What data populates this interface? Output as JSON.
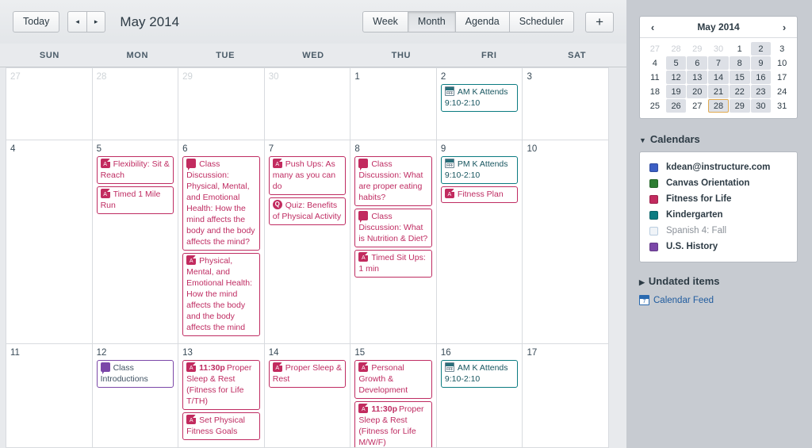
{
  "toolbar": {
    "today_label": "Today",
    "prev_label": "◂",
    "next_label": "▸",
    "month_title": "May 2014",
    "views": [
      {
        "label": "Week",
        "active": false
      },
      {
        "label": "Month",
        "active": true
      },
      {
        "label": "Agenda",
        "active": false
      },
      {
        "label": "Scheduler",
        "active": false
      }
    ],
    "add_label": "+"
  },
  "weekdays": [
    "SUN",
    "MON",
    "TUE",
    "WED",
    "THU",
    "FRI",
    "SAT"
  ],
  "grid": {
    "weeks": [
      {
        "height_class": "r1",
        "days": [
          {
            "num": "27",
            "other": true,
            "events": []
          },
          {
            "num": "28",
            "other": true,
            "events": []
          },
          {
            "num": "29",
            "other": true,
            "events": []
          },
          {
            "num": "30",
            "other": true,
            "events": []
          },
          {
            "num": "1",
            "other": false,
            "events": []
          },
          {
            "num": "2",
            "other": false,
            "events": [
              {
                "icon": "calevent",
                "color": "teal",
                "time": "",
                "title": "AM K Attends 9:10-2:10"
              }
            ]
          },
          {
            "num": "3",
            "other": false,
            "events": []
          }
        ]
      },
      {
        "height_class": "r2",
        "days": [
          {
            "num": "4",
            "other": false,
            "events": []
          },
          {
            "num": "5",
            "other": false,
            "events": [
              {
                "icon": "assignment",
                "color": "pink",
                "time": "",
                "title": "Flexibility: Sit & Reach"
              },
              {
                "icon": "assignment",
                "color": "pink",
                "time": "",
                "title": "Timed 1 Mile Run"
              }
            ]
          },
          {
            "num": "6",
            "other": false,
            "events": [
              {
                "icon": "discussion",
                "color": "pink",
                "time": "",
                "title": "Class Discussion: Physical, Mental, and Emotional Health: How the mind affects the body and the body affects the mind?"
              },
              {
                "icon": "assignment",
                "color": "pink",
                "time": "",
                "title": "Physical, Mental, and Emotional Health: How the mind affects the body and the body affects the mind"
              }
            ]
          },
          {
            "num": "7",
            "other": false,
            "events": [
              {
                "icon": "assignment",
                "color": "pink",
                "time": "",
                "title": "Push Ups: As many as you can do"
              },
              {
                "icon": "quiz",
                "color": "pink",
                "time": "",
                "title": "Quiz: Benefits of Physical Activity"
              }
            ]
          },
          {
            "num": "8",
            "other": false,
            "events": [
              {
                "icon": "discussion",
                "color": "pink",
                "time": "",
                "title": "Class Discussion: What are proper eating habits?"
              },
              {
                "icon": "discussion",
                "color": "pink",
                "time": "",
                "title": "Class Discussion: What is Nutrition & Diet?"
              },
              {
                "icon": "assignment",
                "color": "pink",
                "time": "",
                "title": "Timed Sit Ups: 1 min"
              }
            ]
          },
          {
            "num": "9",
            "other": false,
            "events": [
              {
                "icon": "calevent",
                "color": "teal",
                "time": "",
                "title": "PM K Attends 9:10-2:10"
              },
              {
                "icon": "assignment",
                "color": "pink",
                "time": "",
                "title": "Fitness Plan"
              }
            ]
          },
          {
            "num": "10",
            "other": false,
            "events": []
          }
        ]
      },
      {
        "height_class": "r3",
        "days": [
          {
            "num": "11",
            "other": false,
            "events": []
          },
          {
            "num": "12",
            "other": false,
            "events": [
              {
                "icon": "discussion",
                "color": "purple",
                "time": "",
                "title": "Class Introductions"
              }
            ]
          },
          {
            "num": "13",
            "other": false,
            "events": [
              {
                "icon": "assignment",
                "color": "pink",
                "time": "11:30p",
                "title": "Proper Sleep & Rest (Fitness for Life T/TH)"
              },
              {
                "icon": "assignment",
                "color": "pink",
                "time": "",
                "title": "Set Physical Fitness Goals"
              }
            ]
          },
          {
            "num": "14",
            "other": false,
            "events": [
              {
                "icon": "assignment",
                "color": "pink",
                "time": "",
                "title": "Proper Sleep & Rest"
              }
            ]
          },
          {
            "num": "15",
            "other": false,
            "events": [
              {
                "icon": "assignment",
                "color": "pink",
                "time": "",
                "title": "Personal Growth & Development"
              },
              {
                "icon": "assignment",
                "color": "pink",
                "time": "11:30p",
                "title": "Proper Sleep & Rest (Fitness for Life M/W/F)"
              }
            ]
          },
          {
            "num": "16",
            "other": false,
            "events": [
              {
                "icon": "calevent",
                "color": "teal",
                "time": "",
                "title": "AM K Attends 9:10-2:10"
              }
            ]
          },
          {
            "num": "17",
            "other": false,
            "events": []
          }
        ]
      }
    ]
  },
  "sidebar": {
    "mini": {
      "prev_label": "‹",
      "next_label": "›",
      "title": "May 2014",
      "days": [
        {
          "n": "27",
          "other": true,
          "has": false,
          "today": false
        },
        {
          "n": "28",
          "other": true,
          "has": false,
          "today": false
        },
        {
          "n": "29",
          "other": true,
          "has": false,
          "today": false
        },
        {
          "n": "30",
          "other": true,
          "has": false,
          "today": false
        },
        {
          "n": "1",
          "other": false,
          "has": false,
          "today": false
        },
        {
          "n": "2",
          "other": false,
          "has": true,
          "today": false
        },
        {
          "n": "3",
          "other": false,
          "has": false,
          "today": false
        },
        {
          "n": "4",
          "other": false,
          "has": false,
          "today": false
        },
        {
          "n": "5",
          "other": false,
          "has": true,
          "today": false
        },
        {
          "n": "6",
          "other": false,
          "has": true,
          "today": false
        },
        {
          "n": "7",
          "other": false,
          "has": true,
          "today": false
        },
        {
          "n": "8",
          "other": false,
          "has": true,
          "today": false
        },
        {
          "n": "9",
          "other": false,
          "has": true,
          "today": false
        },
        {
          "n": "10",
          "other": false,
          "has": false,
          "today": false
        },
        {
          "n": "11",
          "other": false,
          "has": false,
          "today": false
        },
        {
          "n": "12",
          "other": false,
          "has": true,
          "today": false
        },
        {
          "n": "13",
          "other": false,
          "has": true,
          "today": false
        },
        {
          "n": "14",
          "other": false,
          "has": true,
          "today": false
        },
        {
          "n": "15",
          "other": false,
          "has": true,
          "today": false
        },
        {
          "n": "16",
          "other": false,
          "has": true,
          "today": false
        },
        {
          "n": "17",
          "other": false,
          "has": false,
          "today": false
        },
        {
          "n": "18",
          "other": false,
          "has": false,
          "today": false
        },
        {
          "n": "19",
          "other": false,
          "has": true,
          "today": false
        },
        {
          "n": "20",
          "other": false,
          "has": true,
          "today": false
        },
        {
          "n": "21",
          "other": false,
          "has": true,
          "today": false
        },
        {
          "n": "22",
          "other": false,
          "has": true,
          "today": false
        },
        {
          "n": "23",
          "other": false,
          "has": true,
          "today": false
        },
        {
          "n": "24",
          "other": false,
          "has": false,
          "today": false
        },
        {
          "n": "25",
          "other": false,
          "has": false,
          "today": false
        },
        {
          "n": "26",
          "other": false,
          "has": true,
          "today": false
        },
        {
          "n": "27",
          "other": false,
          "has": false,
          "today": false
        },
        {
          "n": "28",
          "other": false,
          "has": true,
          "today": true
        },
        {
          "n": "29",
          "other": false,
          "has": true,
          "today": false
        },
        {
          "n": "30",
          "other": false,
          "has": true,
          "today": false
        },
        {
          "n": "31",
          "other": false,
          "has": false,
          "today": false
        }
      ]
    },
    "calendars_title": "Calendars",
    "calendars": [
      {
        "name": "kdean@instructure.com",
        "color": "#3c5fc4",
        "enabled": true
      },
      {
        "name": "Canvas Orientation",
        "color": "#2e7d32",
        "enabled": true
      },
      {
        "name": "Fitness for Life",
        "color": "#c22b5f",
        "enabled": true
      },
      {
        "name": "Kindergarten",
        "color": "#0b7b81",
        "enabled": true
      },
      {
        "name": "Spanish 4: Fall",
        "color": "#eef4f9",
        "enabled": false
      },
      {
        "name": "U.S. History",
        "color": "#7b47a8",
        "enabled": true
      }
    ],
    "undated_title": "Undated items",
    "feed_label": "Calendar Feed"
  }
}
